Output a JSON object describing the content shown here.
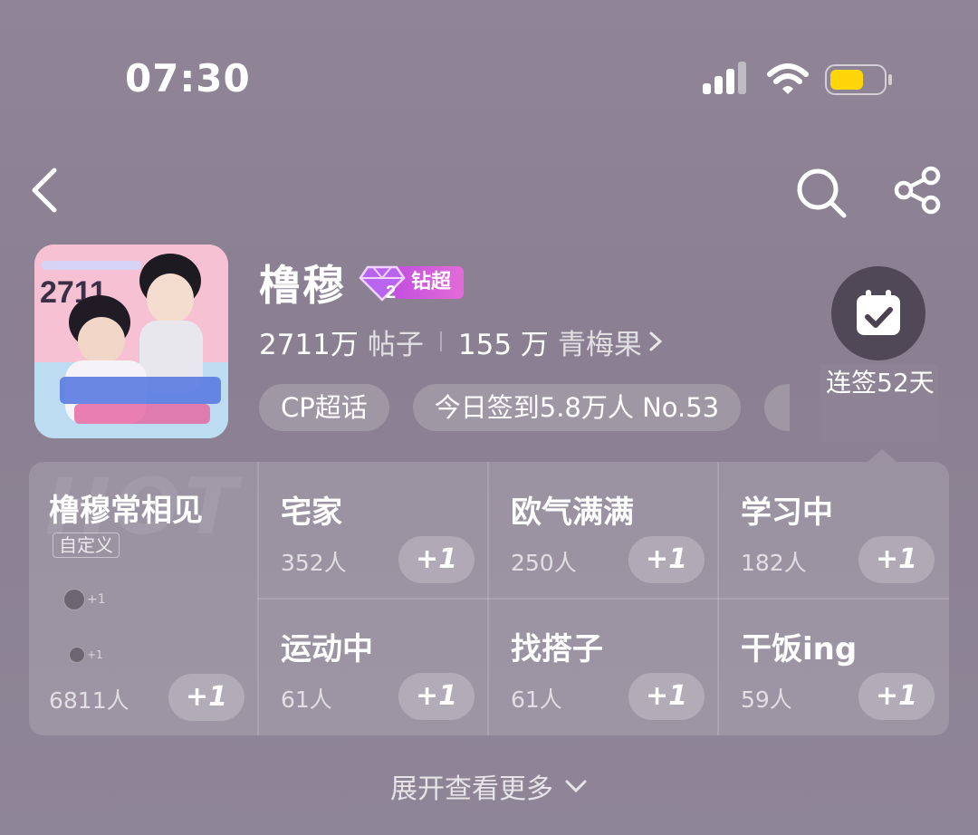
{
  "status_bar": {
    "time": "07:30",
    "battery_color": "#ffd60a"
  },
  "header": {
    "title": "橹穆",
    "badge_level": "2",
    "badge_label": "钻超",
    "stats": [
      {
        "value": "2711万",
        "label": "帖子"
      },
      {
        "value": "155 万",
        "label": "青梅果"
      }
    ],
    "chips": [
      "CP超话",
      "今日签到5.8万人 No.53"
    ]
  },
  "checkin": {
    "text": "连签52天"
  },
  "panel": {
    "main": {
      "title": "橹穆常相见",
      "tag": "自定义",
      "count": "6811人",
      "plus_label": "+1",
      "mini_plus": "+1"
    },
    "cells": [
      {
        "title": "宅家",
        "count": "352人",
        "plus_label": "+1"
      },
      {
        "title": "欧气满满",
        "count": "250人",
        "plus_label": "+1"
      },
      {
        "title": "学习中",
        "count": "182人",
        "plus_label": "+1"
      },
      {
        "title": "运动中",
        "count": "61人",
        "plus_label": "+1"
      },
      {
        "title": "找搭子",
        "count": "61人",
        "plus_label": "+1"
      },
      {
        "title": "干饭ing",
        "count": "59人",
        "plus_label": "+1"
      }
    ]
  },
  "expand_label": "展开查看更多"
}
